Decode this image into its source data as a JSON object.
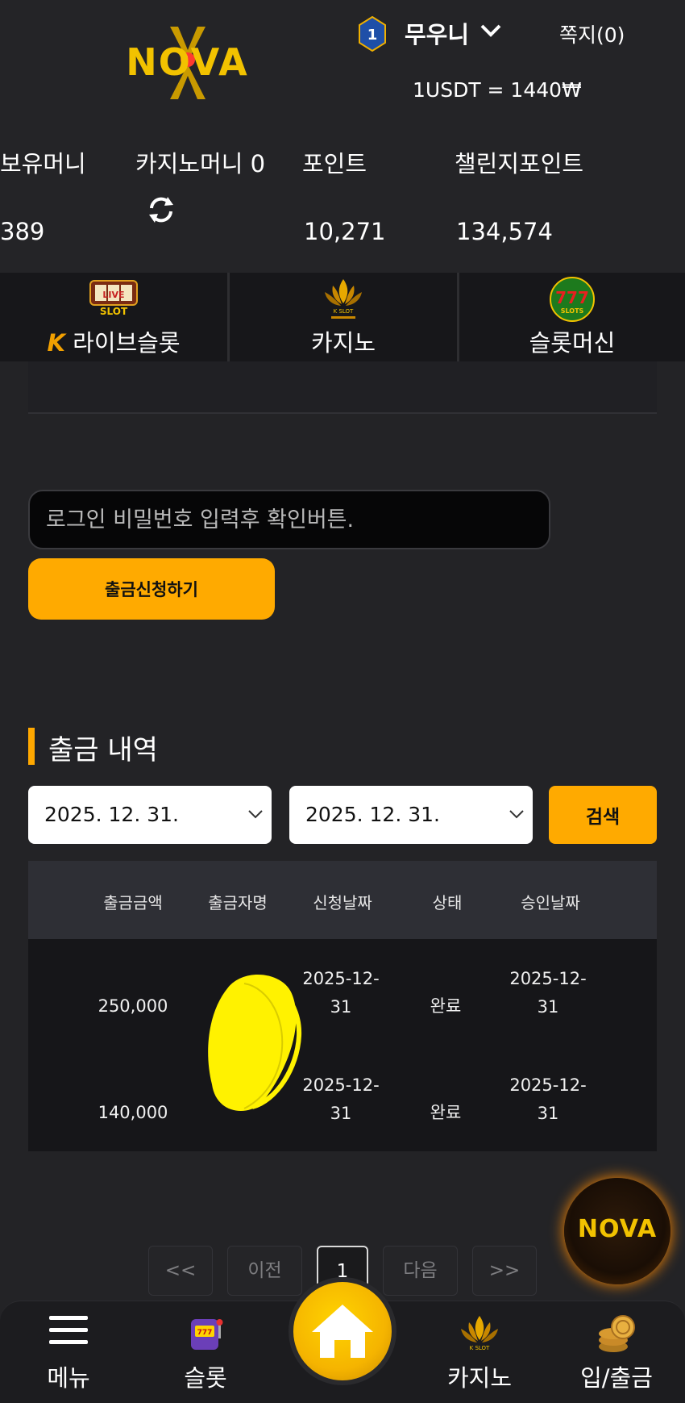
{
  "header": {
    "logo_text": "NOVA",
    "level": "1",
    "username": "무우니",
    "messages": "쪽지(0)",
    "rate": "1USDT = 1440₩"
  },
  "balances": [
    {
      "label": "보유머니",
      "value": "389"
    },
    {
      "label": "카지노머니 0",
      "value": ""
    },
    {
      "label": "포인트",
      "value": "10,271"
    },
    {
      "label": "챌린지포인트",
      "value": "134,574"
    }
  ],
  "tabs": [
    {
      "label": "라이브슬롯",
      "icon": "live-slot-icon",
      "badge": "K"
    },
    {
      "label": "카지노",
      "icon": "kslot-icon"
    },
    {
      "label": "슬롯머신",
      "icon": "777-slots-icon"
    }
  ],
  "withdraw": {
    "password_placeholder": "로그인 비밀번호 입력후 확인버튼.",
    "submit_label": "출금신청하기"
  },
  "history": {
    "title": "출금 내역",
    "start_date": "2025. 12. 31.",
    "end_date": "2025. 12. 31.",
    "search_label": "검색",
    "columns": [
      "출금금액",
      "출금자명",
      "신청날짜",
      "상태",
      "승인날짜"
    ],
    "rows": [
      {
        "amount": "250,000",
        "name": "",
        "req_date_1": "2025-12-",
        "req_date_2": "31",
        "status": "완료",
        "appr_date_1": "2025-12-",
        "appr_date_2": "31"
      },
      {
        "amount": "140,000",
        "name": "",
        "req_date_1": "2025-12-",
        "req_date_2": "31",
        "status": "완료",
        "appr_date_1": "2025-12-",
        "appr_date_2": "31"
      }
    ]
  },
  "pagination": {
    "first": "<<",
    "prev": "이전",
    "current": "1",
    "next": "다음",
    "last": ">>"
  },
  "fab": {
    "label": "NOVA"
  },
  "bottom_nav": [
    {
      "label": "메뉴",
      "icon": "hamburger-icon"
    },
    {
      "label": "슬롯",
      "icon": "slot-machine-icon"
    },
    {
      "label": "",
      "icon": "home-icon"
    },
    {
      "label": "카지노",
      "icon": "kslot-icon"
    },
    {
      "label": "입/출금",
      "icon": "coins-icon"
    }
  ],
  "colors": {
    "accent": "#ffaa00",
    "background": "#232326",
    "logo": "#f2c200"
  }
}
